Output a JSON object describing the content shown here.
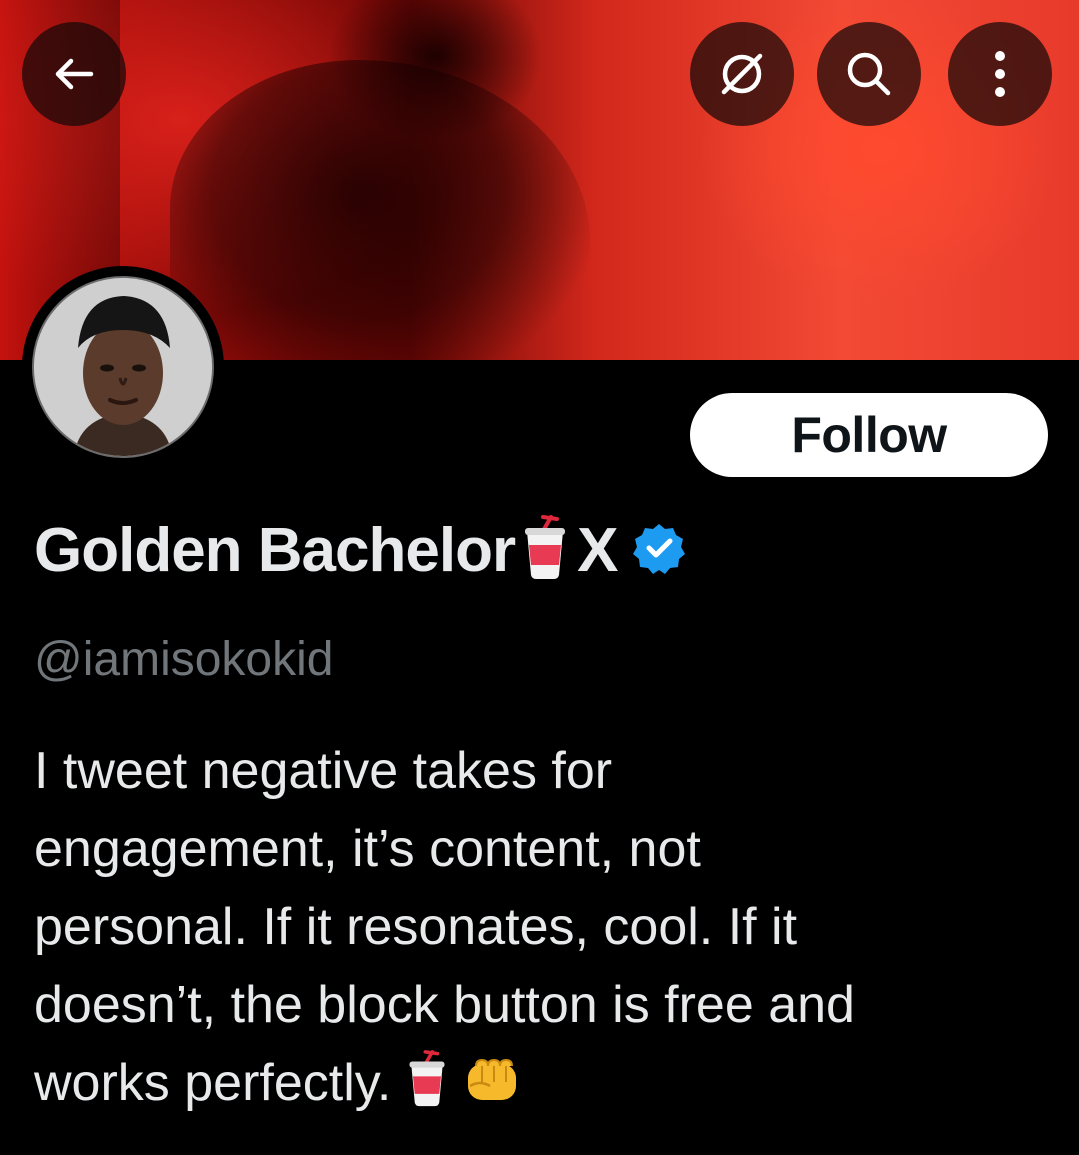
{
  "header": {
    "back_icon": "arrow-left-icon",
    "grok_icon": "slashed-circle-icon",
    "search_icon": "search-icon",
    "more_icon": "more-vertical-icon"
  },
  "profile": {
    "display_name": "Golden Bachelor",
    "name_emoji": "cup-with-straw",
    "name_suffix": "X",
    "verified": true,
    "handle": "@iamisokokid",
    "follow_label": "Follow",
    "bio_lines": [
      "I tweet negative takes for",
      "engagement, it’s content, not",
      "personal. If it resonates, cool. If it",
      "doesn’t, the block button is free and",
      "works perfectly."
    ],
    "bio_trailing_emoji": [
      "cup-with-straw",
      "oncoming-fist"
    ]
  },
  "colors": {
    "background": "#000000",
    "verified_blue": "#1d9bf0",
    "handle_gray": "#71767b",
    "text": "#e7e9ea",
    "banner_red": "#d8201a"
  }
}
